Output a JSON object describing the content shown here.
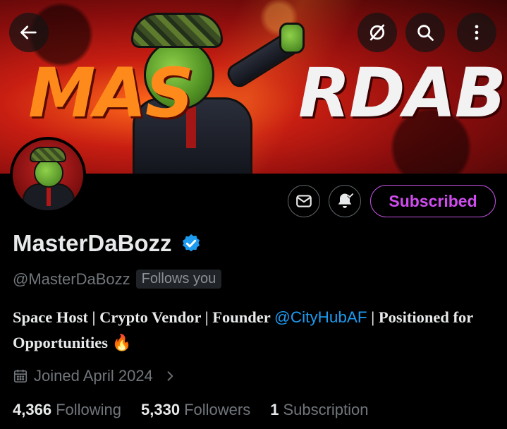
{
  "banner": {
    "text_part1": "MAS",
    "text_part2": "RDABOZZ"
  },
  "top_bar": {
    "back_icon": "arrow-left-icon",
    "grok_icon": "grok-slash-icon",
    "search_icon": "search-icon",
    "more_icon": "more-vertical-icon"
  },
  "actions": {
    "message_icon": "envelope-icon",
    "notify_icon": "bell-check-icon",
    "subscribed_label": "Subscribed"
  },
  "profile": {
    "display_name": "MasterDaBozz",
    "verified_icon": "verified-badge-icon",
    "handle": "@MasterDaBozz",
    "follows_you": "Follows you",
    "bio_part1": "Space Host | Crypto Vendor | Founder ",
    "bio_mention": "@CityHubAF",
    "bio_part2": " | Positioned for Opportunities ",
    "bio_emoji": "🔥",
    "joined": "Joined April 2024"
  },
  "stats": {
    "following_count": "4,366",
    "following_label": "Following",
    "followers_count": "5,330",
    "followers_label": "Followers",
    "subscription_count": "1",
    "subscription_label": "Subscription"
  },
  "colors": {
    "accent_purple": "#d04cf0",
    "link_blue": "#1d9bf0",
    "verified_blue": "#1d9bf0",
    "muted": "#71767b"
  }
}
